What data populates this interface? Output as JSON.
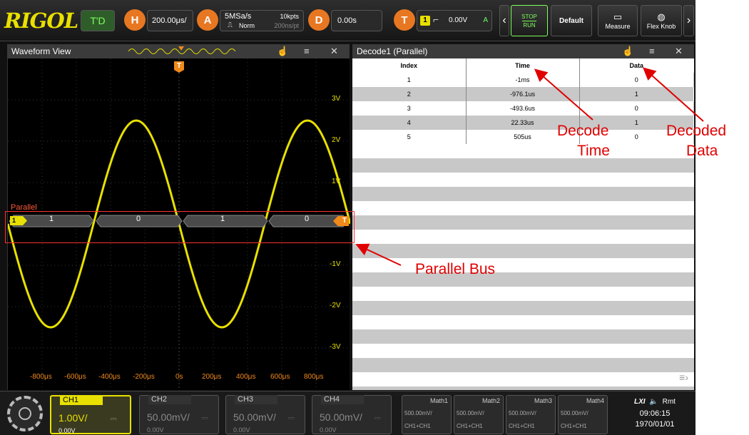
{
  "topbar": {
    "brand": "RIGOL",
    "trig_status": "T'D",
    "h_label": "H",
    "h_scale": "200.00μs/",
    "a_label": "A",
    "sample_rate": "5MSa/s",
    "mem_depth": "10kpts",
    "acq_mode": "Norm",
    "acq_res": "200ns/pt",
    "d_label": "D",
    "delay": "0.00s",
    "t_label": "T",
    "trig_ch": "1",
    "trig_level": "0.00V",
    "trig_mode": "A",
    "stop_label": "STOP",
    "run_label": "RUN",
    "default_label": "Default",
    "measure_label": "Measure",
    "flexknob_label": "Flex Knob"
  },
  "waveform": {
    "title": "Waveform View",
    "trigger_marker": "T",
    "ch_marker": "1",
    "bus_label": "Parallel",
    "bus_values": [
      "1",
      "0",
      "1",
      "0"
    ],
    "bus_trigger": "T",
    "y_labels": [
      "3V",
      "2V",
      "1V",
      "-1V",
      "-2V",
      "-3V"
    ],
    "x_labels": [
      "-800μs",
      "-600μs",
      "-400μs",
      "-200μs",
      "0s",
      "200μs",
      "400μs",
      "600μs",
      "800μs"
    ]
  },
  "decode": {
    "title": "Decode1 (Parallel)",
    "columns": [
      "Index",
      "Time",
      "Data"
    ],
    "rows": [
      [
        "1",
        "-1ms",
        "0"
      ],
      [
        "2",
        "-976.1us",
        "1"
      ],
      [
        "3",
        "-493.6us",
        "0"
      ],
      [
        "4",
        "22.33us",
        "1"
      ],
      [
        "5",
        "505us",
        "0"
      ]
    ]
  },
  "annotations": {
    "decode_time": [
      "Decode",
      "Time"
    ],
    "decoded_data": [
      "Decoded",
      "Data"
    ],
    "parallel_bus": "Parallel Bus"
  },
  "bottombar": {
    "channels": [
      {
        "name": "CH1",
        "scale": "1.00V/",
        "offset": "0.00V"
      },
      {
        "name": "CH2",
        "scale": "50.00mV/",
        "offset": "0.00V"
      },
      {
        "name": "CH3",
        "scale": "50.00mV/",
        "offset": "0.00V"
      },
      {
        "name": "CH4",
        "scale": "50.00mV/",
        "offset": "0.00V"
      }
    ],
    "maths": [
      {
        "name": "Math1",
        "scale": "500.00mV/",
        "src": "CH1+CH1"
      },
      {
        "name": "Math2",
        "scale": "500.00mV/",
        "src": "CH1+CH1"
      },
      {
        "name": "Math3",
        "scale": "500.00mV/",
        "src": "CH1+CH1"
      },
      {
        "name": "Math4",
        "scale": "500.00mV/",
        "src": "CH1+CH1"
      }
    ],
    "lxi": "LXI",
    "remote": "Rmt",
    "time": "09:06:15",
    "date": "1970/01/01"
  },
  "colors": {
    "ch1": "#e8e000",
    "trigger": "#f08a1a",
    "annotation": "#e00000",
    "highlight": "#ff3030"
  }
}
